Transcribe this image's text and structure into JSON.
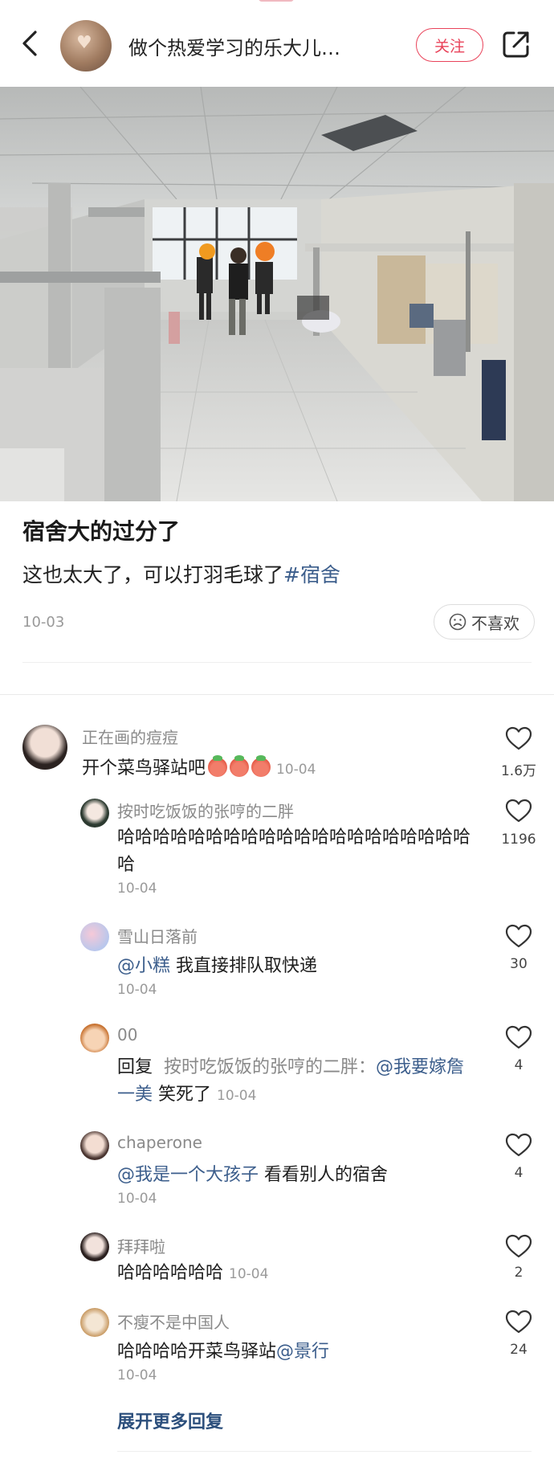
{
  "header": {
    "author_name": "做个热爱学习的乐大儿…",
    "follow_label": "关注",
    "avatar_icon": "heart-hands-avatar",
    "accent_color": "#e9435a"
  },
  "post": {
    "title": "宿舍大的过分了",
    "body_text": "这也太大了，可以打羽毛球了",
    "hashtag": "#宿舍",
    "date": "10-03",
    "dislike_label": "不喜欢"
  },
  "comments": [
    {
      "name": "正在画的痘痘",
      "text": "开个菜鸟驿站吧",
      "emoji_count": 3,
      "date": "10-04",
      "likes": "1.6万"
    },
    {
      "name": "按时吃饭饭的张哼的二胖",
      "text": "哈哈哈哈哈哈哈哈哈哈哈哈哈哈哈哈哈哈哈哈哈",
      "date": "10-04",
      "likes": "1196"
    },
    {
      "name": "雪山日落前",
      "mention": "@小糕",
      "text": " 我直接排队取快递",
      "date": "10-04",
      "likes": "30"
    },
    {
      "name": "00",
      "reply_label": "回复",
      "reply_to": "按时吃饭饭的张哼的二胖：",
      "mention": "@我要嫁詹一美",
      "text": " 笑死了",
      "date": "10-04",
      "likes": "4"
    },
    {
      "name": "chaperone",
      "mention": "@我是一个大孩子",
      "text": " 看看别人的宿舍",
      "date": "10-04",
      "likes": "4"
    },
    {
      "name": "拜拜啦",
      "text": "哈哈哈哈哈哈",
      "date": "10-04",
      "likes": "2"
    },
    {
      "name": "不瘦不是中国人",
      "text": "哈哈哈哈开菜鸟驿站",
      "mention": "@景行",
      "date": "10-04",
      "likes": "24"
    }
  ],
  "more_replies_label": "展开更多回复"
}
